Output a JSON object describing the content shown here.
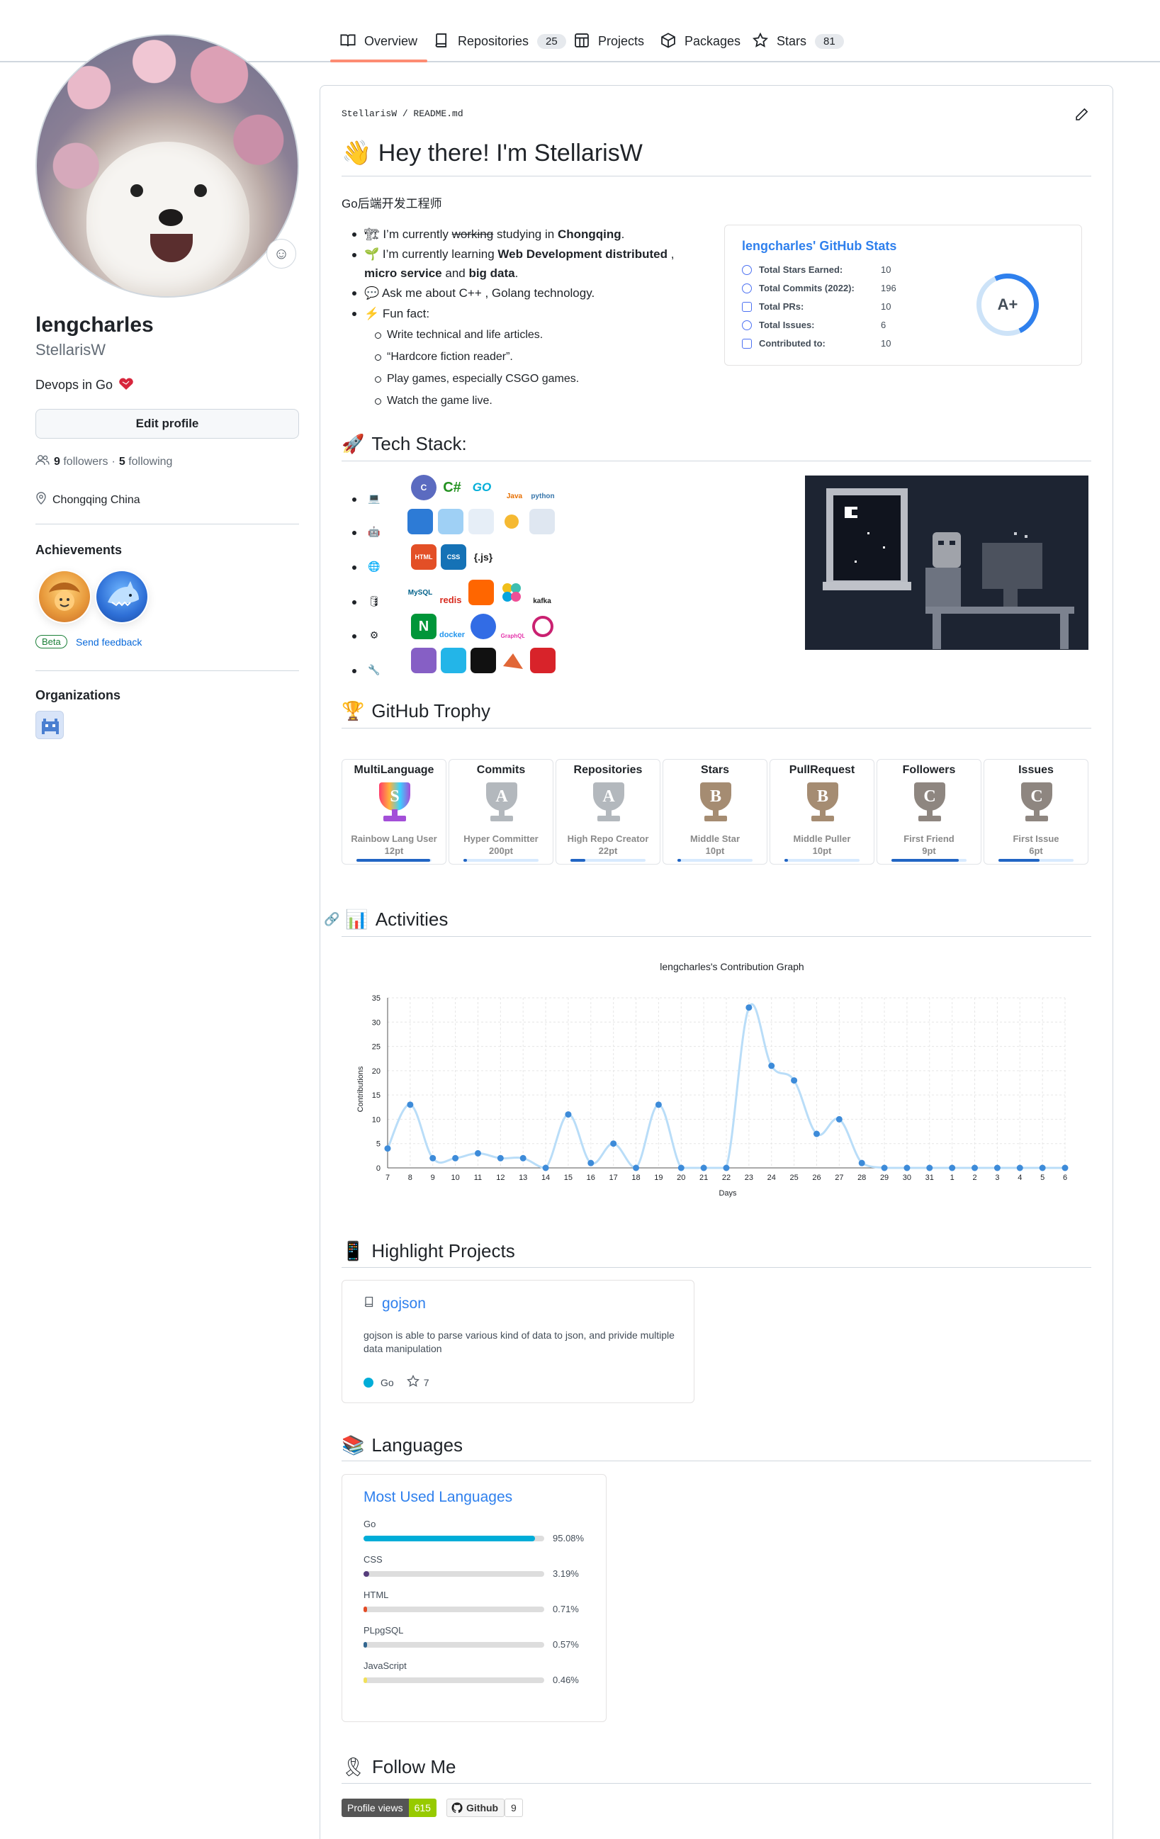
{
  "tabs": [
    {
      "label": "Overview",
      "count": ""
    },
    {
      "label": "Repositories",
      "count": "25"
    },
    {
      "label": "Projects",
      "count": ""
    },
    {
      "label": "Packages",
      "count": ""
    },
    {
      "label": "Stars",
      "count": "81"
    }
  ],
  "profile": {
    "name": "lengcharles",
    "login": "StellarisW",
    "bio": "Devops in Go",
    "edit_label": "Edit profile",
    "followers_count": "9",
    "followers_label": "followers",
    "following_count": "5",
    "following_label": "following",
    "location": "Chongqing China",
    "achievements_title": "Achievements",
    "beta_label": "Beta",
    "feedback_label": "Send feedback",
    "orgs_title": "Organizations"
  },
  "readme": {
    "path_user": "StellarisW",
    "path_file": "README.md",
    "title": "Hey there! I'm StellarisW",
    "title_emoji": "👋",
    "subtitle": "Go后端开发工程师",
    "bullets": {
      "b1_pre": "I’m currently ",
      "b1_strike": "working",
      "b1_mid": " studying in ",
      "b1_bold": "Chongqing",
      "b1_end": ".",
      "b2_pre": "I’m currently learning ",
      "b2_bold1": "Web Development distributed",
      "b2_mid": " , ",
      "b2_bold2": "micro service",
      "b2_and": " and ",
      "b2_bold3": "big data",
      "b2_end": ".",
      "b3": "Ask me about C++ , Golang technology.",
      "b4": "Fun fact:",
      "fun": [
        "Write technical and life articles.",
        "“Hardcore fiction reader”.",
        "Play games, especially CSGO games.",
        "Watch the game live."
      ]
    },
    "tech_title": "Tech Stack:",
    "trophy_title": "GitHub Trophy",
    "activities_title": "Activities",
    "highlight_title": "Highlight Projects",
    "languages_title": "Languages",
    "follow_title": "Follow Me"
  },
  "stats": {
    "title": "lengcharles' GitHub Stats",
    "rows": [
      {
        "label": "Total Stars Earned:",
        "value": "10"
      },
      {
        "label": "Total Commits (2022):",
        "value": "196"
      },
      {
        "label": "Total PRs:",
        "value": "10"
      },
      {
        "label": "Total Issues:",
        "value": "6"
      },
      {
        "label": "Contributed to:",
        "value": "10"
      }
    ],
    "rank": "A+"
  },
  "tech_logos": {
    "row1": [
      "C",
      "C#",
      "GO",
      "Java",
      "python"
    ],
    "row3": [
      "HTML",
      "CSS",
      "{.js}"
    ],
    "row4": [
      "MySQL",
      "redis",
      "",
      "",
      "kafka"
    ],
    "row5": [
      "N",
      "docker",
      "",
      "GraphQL",
      ""
    ]
  },
  "trophies": [
    {
      "title": "MultiLanguage",
      "rank": "S",
      "sub": "Rainbow Lang User",
      "pt": "12pt",
      "progress": 0.98
    },
    {
      "title": "Commits",
      "rank": "A",
      "sub": "Hyper Committer",
      "pt": "200pt",
      "progress": 0.05
    },
    {
      "title": "Repositories",
      "rank": "A",
      "sub": "High Repo Creator",
      "pt": "22pt",
      "progress": 0.2
    },
    {
      "title": "Stars",
      "rank": "B",
      "sub": "Middle Star",
      "pt": "10pt",
      "progress": 0.05
    },
    {
      "title": "PullRequest",
      "rank": "B",
      "sub": "Middle Puller",
      "pt": "10pt",
      "progress": 0.05
    },
    {
      "title": "Followers",
      "rank": "C",
      "sub": "First Friend",
      "pt": "9pt",
      "progress": 0.9
    },
    {
      "title": "Issues",
      "rank": "C",
      "sub": "First Issue",
      "pt": "6pt",
      "progress": 0.55
    }
  ],
  "chart_data": {
    "type": "line",
    "title": "lengcharles's Contribution Graph",
    "xlabel": "Days",
    "ylabel": "Contributions",
    "x": [
      "7",
      "8",
      "9",
      "10",
      "11",
      "12",
      "13",
      "14",
      "15",
      "16",
      "17",
      "18",
      "19",
      "20",
      "21",
      "22",
      "23",
      "24",
      "25",
      "26",
      "27",
      "28",
      "29",
      "30",
      "31",
      "1",
      "2",
      "3",
      "4",
      "5",
      "6"
    ],
    "values": [
      4,
      13,
      2,
      2,
      3,
      2,
      2,
      0,
      11,
      1,
      5,
      0,
      13,
      0,
      0,
      0,
      33,
      21,
      18,
      7,
      10,
      1,
      0,
      0,
      0,
      0,
      0,
      0,
      0,
      0,
      0
    ],
    "ylim": [
      0,
      35
    ],
    "yticks": [
      0,
      5,
      10,
      15,
      20,
      25,
      30,
      35
    ],
    "grid": true,
    "color": "#b9ddf8",
    "point_color": "#3d8bd9"
  },
  "project": {
    "name": "gojson",
    "desc": "gojson is able to parse various kind of data to json, and privide multiple data manipulation",
    "lang": "Go",
    "stars": "7"
  },
  "languages": {
    "title": "Most Used Languages",
    "items": [
      {
        "name": "Go",
        "pct": "95.08%",
        "value": 95.08,
        "color": "#00ADD8"
      },
      {
        "name": "CSS",
        "pct": "3.19%",
        "value": 3.19,
        "color": "#563d7c"
      },
      {
        "name": "HTML",
        "pct": "0.71%",
        "value": 0.71,
        "color": "#e34c26"
      },
      {
        "name": "PLpgSQL",
        "pct": "0.57%",
        "value": 0.57,
        "color": "#336790"
      },
      {
        "name": "JavaScript",
        "pct": "0.46%",
        "value": 0.46,
        "color": "#f1e05a"
      }
    ]
  },
  "follow": {
    "views_label": "Profile views",
    "views_count": "615",
    "github_label": "Github",
    "github_count": "9"
  },
  "colors": {
    "accent": "#fd8c73",
    "link": "#0969da",
    "card_title": "#2f80ed"
  }
}
